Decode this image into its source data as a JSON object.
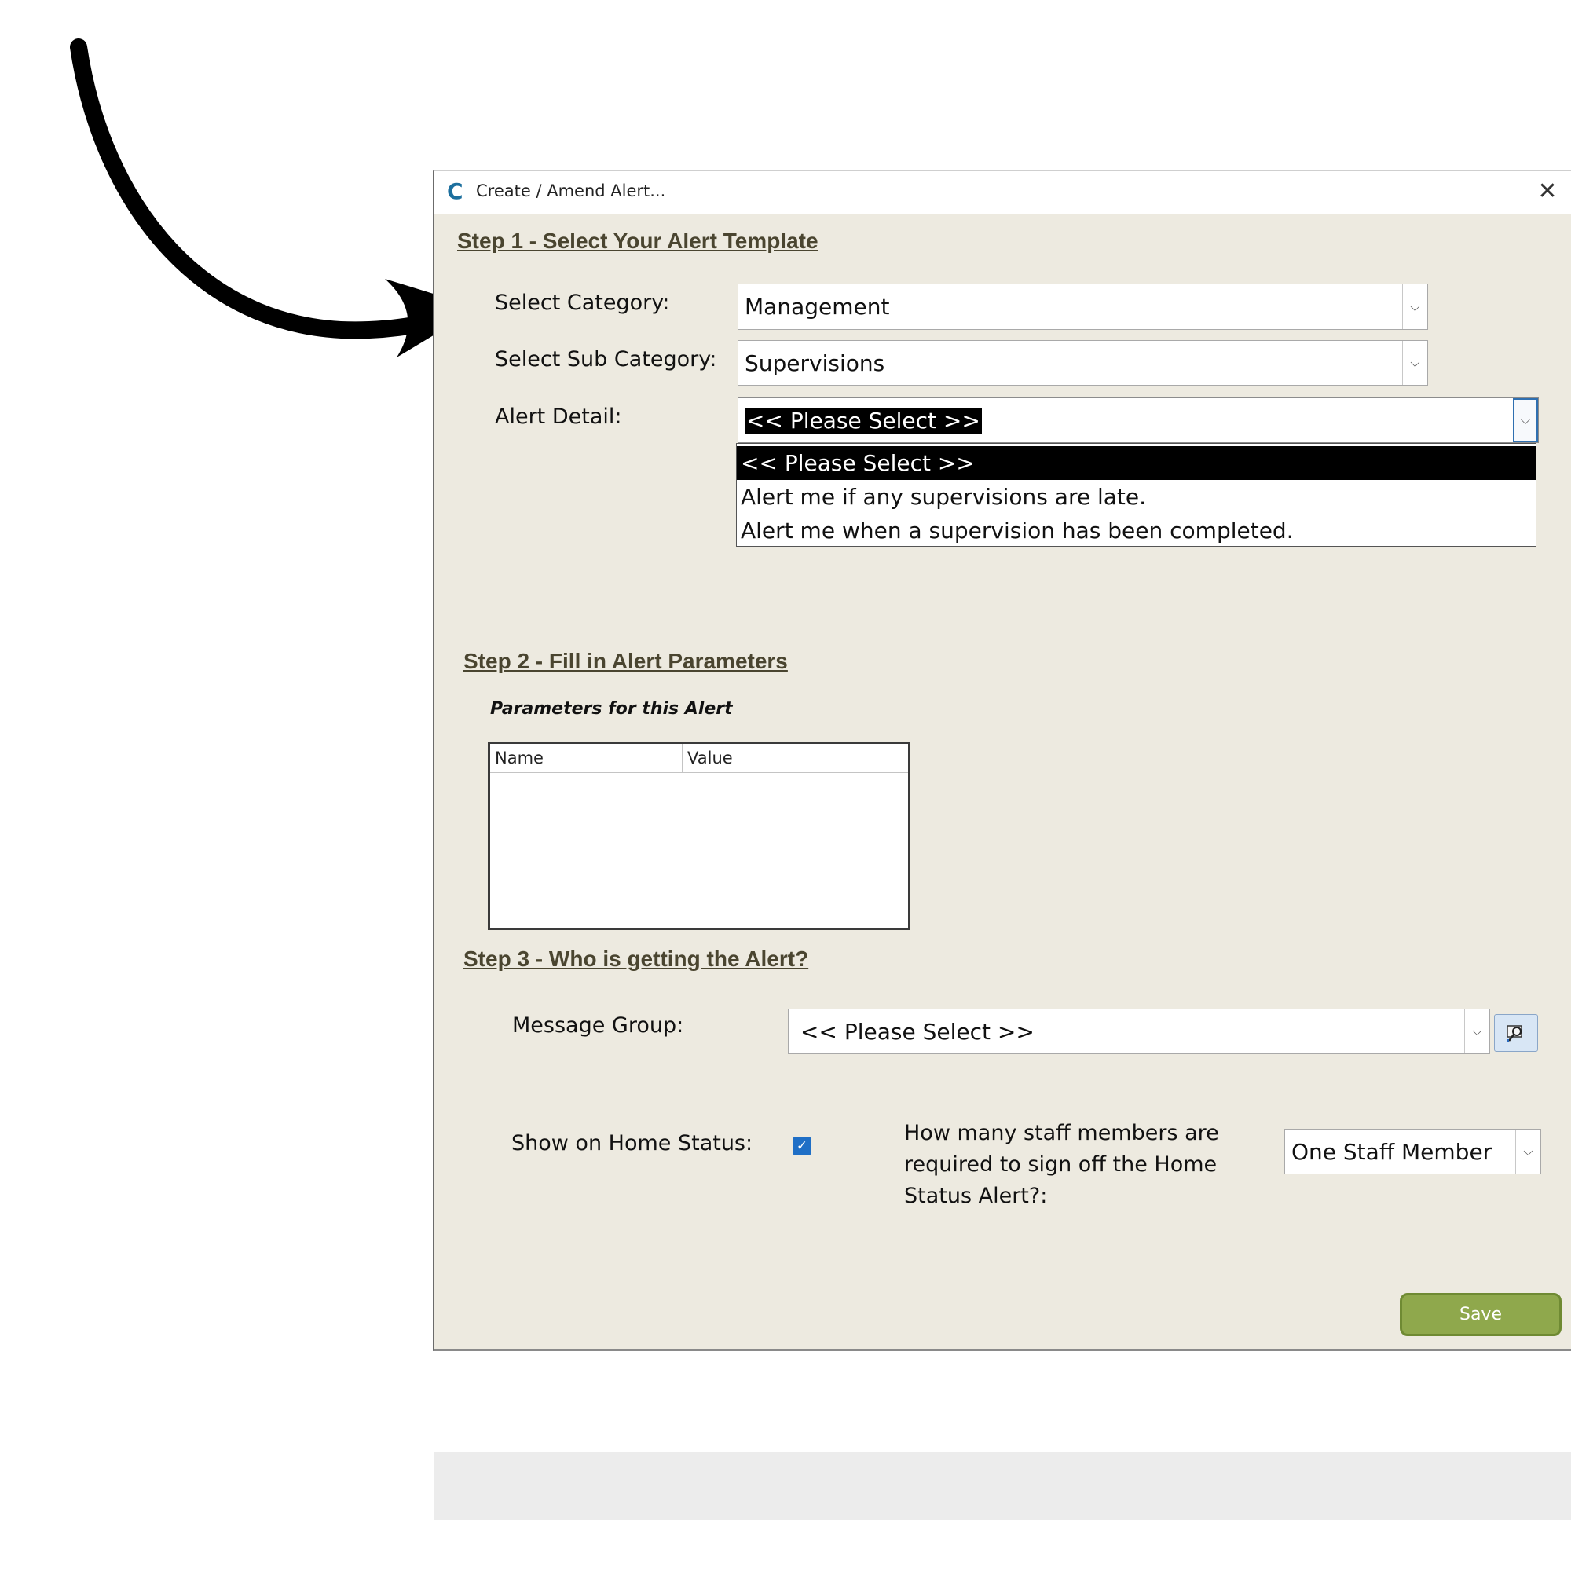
{
  "window": {
    "title": "Create / Amend Alert...",
    "close_glyph": "✕"
  },
  "step1": {
    "heading": "Step 1 - Select Your Alert Template",
    "category_label": "Select Category:",
    "category_value": "Management",
    "subcategory_label": "Select Sub Category:",
    "subcategory_value": "Supervisions",
    "alert_detail_label": "Alert Detail:",
    "alert_detail_value": "<< Please Select >>",
    "alert_detail_options": [
      "<< Please Select >>",
      "Alert me if any supervisions are late.",
      "Alert me when a supervision has been completed."
    ]
  },
  "step2": {
    "heading": "Step 2 - Fill in Alert Parameters",
    "caption": "Parameters for this Alert",
    "columns": [
      "Name",
      "Value"
    ]
  },
  "step3": {
    "heading": "Step 3 - Who is getting the Alert?",
    "message_group_label": "Message Group:",
    "message_group_value": "<< Please Select >>",
    "show_home_status_label": "Show on Home Status:",
    "show_home_status_checked": true,
    "signoff_question": "How many staff members are required to sign off the Home Status Alert?:",
    "signoff_value": "One Staff Member"
  },
  "footer": {
    "save_label": "Save"
  },
  "icons": {
    "app": "app-logo-icon",
    "dropdown": "chevron-down-icon",
    "lookup": "lookup-icon",
    "check": "checkmark-icon"
  },
  "colors": {
    "dialog_bg": "#edeae0",
    "heading": "#4a4530",
    "save_button": "#8fa84c",
    "checkbox": "#1f6fc6"
  }
}
